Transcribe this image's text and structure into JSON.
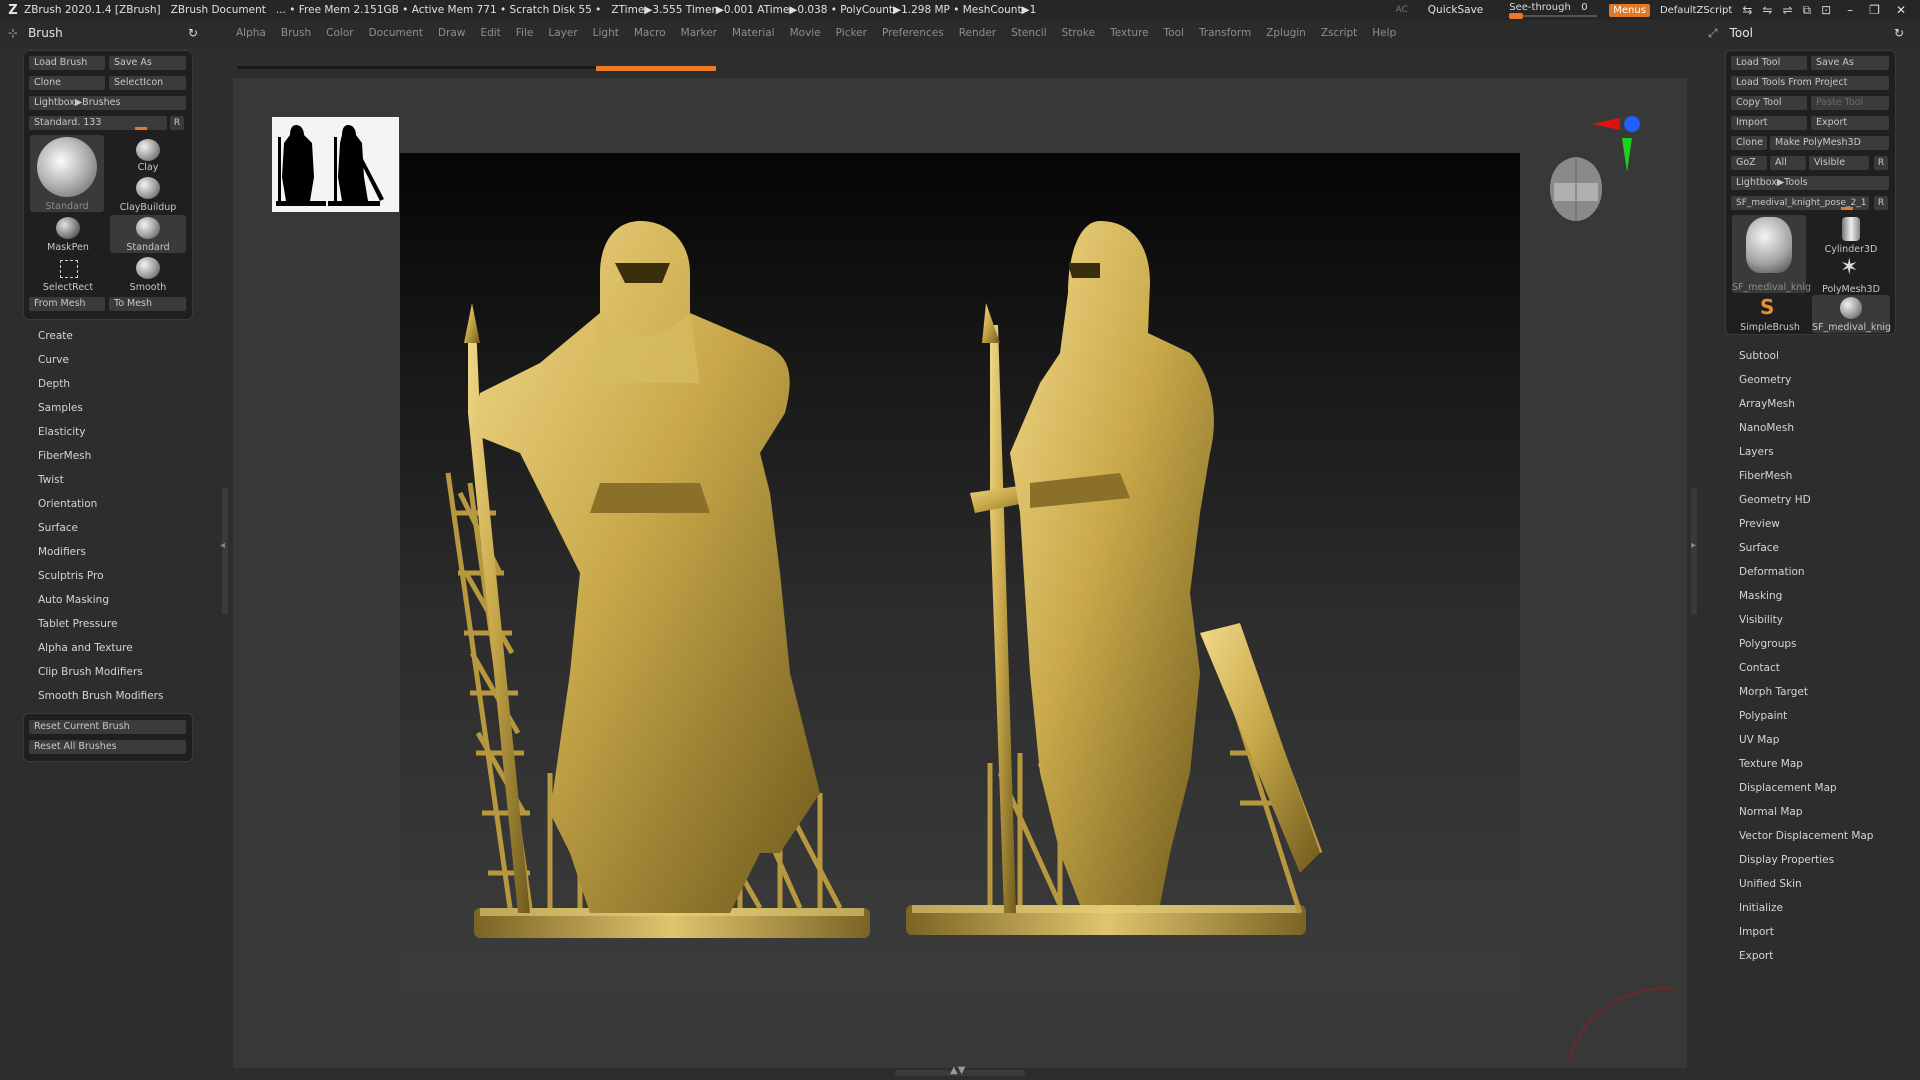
{
  "titlebar": {
    "app": "ZBrush 2020.1.4 [ZBrush]",
    "document": "ZBrush Document",
    "free_mem": "... • Free Mem 2.151GB • Active Mem 771 • Scratch Disk 55 •",
    "timers": "ZTime▶3.555 Timer▶0.001 ATime▶0.038 • PolyCount▶1.298 MP • MeshCount▶1",
    "ac": "AC",
    "quicksave": "QuickSave",
    "see_through_label": "See-through",
    "see_through_value": "0",
    "see_through_level": 0,
    "menus": "Menus",
    "script": "DefaultZScript"
  },
  "menubar": [
    "Alpha",
    "Brush",
    "Color",
    "Document",
    "Draw",
    "Edit",
    "File",
    "Layer",
    "Light",
    "Macro",
    "Marker",
    "Material",
    "Movie",
    "Picker",
    "Preferences",
    "Render",
    "Stencil",
    "Stroke",
    "Texture",
    "Tool",
    "Transform",
    "Zplugin",
    "Zscript",
    "Help"
  ],
  "brush_panel": {
    "title": "Brush",
    "load_brush": "Load Brush",
    "save_as": "Save As",
    "clone": "Clone",
    "select_icon": "SelectIcon",
    "lightbox": "Lightbox▶Brushes",
    "slider_label": "Standard. 133",
    "slider_level": 0.72,
    "r": "R",
    "thumbs": {
      "big": "Standard",
      "clay": "Clay",
      "claybuildup": "ClayBuildup",
      "maskpen": "MaskPen",
      "standard2": "Standard",
      "selectrect": "SelectRect",
      "smooth": "Smooth"
    },
    "from_mesh": "From Mesh",
    "to_mesh": "To Mesh",
    "sections": [
      "Create",
      "Curve",
      "Depth",
      "Samples",
      "Elasticity",
      "FiberMesh",
      "Twist",
      "Orientation",
      "Surface",
      "Modifiers",
      "Sculptris Pro",
      "Auto Masking",
      "Tablet Pressure",
      "Alpha and Texture",
      "Clip Brush Modifiers",
      "Smooth Brush Modifiers"
    ],
    "reset_current": "Reset Current Brush",
    "reset_all": "Reset All Brushes"
  },
  "tool_panel": {
    "title": "Tool",
    "load_tool": "Load Tool",
    "save_as": "Save As",
    "load_from_project": "Load Tools From Project",
    "copy_tool": "Copy Tool",
    "paste_tool": "Paste Tool",
    "import": "Import",
    "export": "Export",
    "clone": "Clone",
    "make_polymesh": "Make PolyMesh3D",
    "goz": "GoZ",
    "all": "All",
    "visible": "Visible",
    "r": "R",
    "lightbox": "Lightbox▶Tools",
    "current_tool": "SF_medival_knight_pose_2_1",
    "thumbs": {
      "t1": "SF_medival_knig",
      "t2": "Cylinder3D",
      "t3": "PolyMesh3D",
      "t4": "SimpleBrush",
      "t5": "SF_medival_knig"
    },
    "sections": [
      "Subtool",
      "Geometry",
      "ArrayMesh",
      "NanoMesh",
      "Layers",
      "FiberMesh",
      "Geometry HD",
      "Preview",
      "Surface",
      "Deformation",
      "Masking",
      "Visibility",
      "Polygroups",
      "Contact",
      "Morph Target",
      "Polypaint",
      "UV Map",
      "Texture Map",
      "Displacement Map",
      "Normal Map",
      "Vector Displacement Map",
      "Display Properties",
      "Unified Skin",
      "Initialize",
      "Import",
      "Export"
    ]
  },
  "colors": {
    "accent": "#e87a28",
    "gold": "#c9a94a",
    "gizmo_x": "#e01010",
    "gizmo_y": "#20d020",
    "gizmo_z": "#2060ff"
  }
}
